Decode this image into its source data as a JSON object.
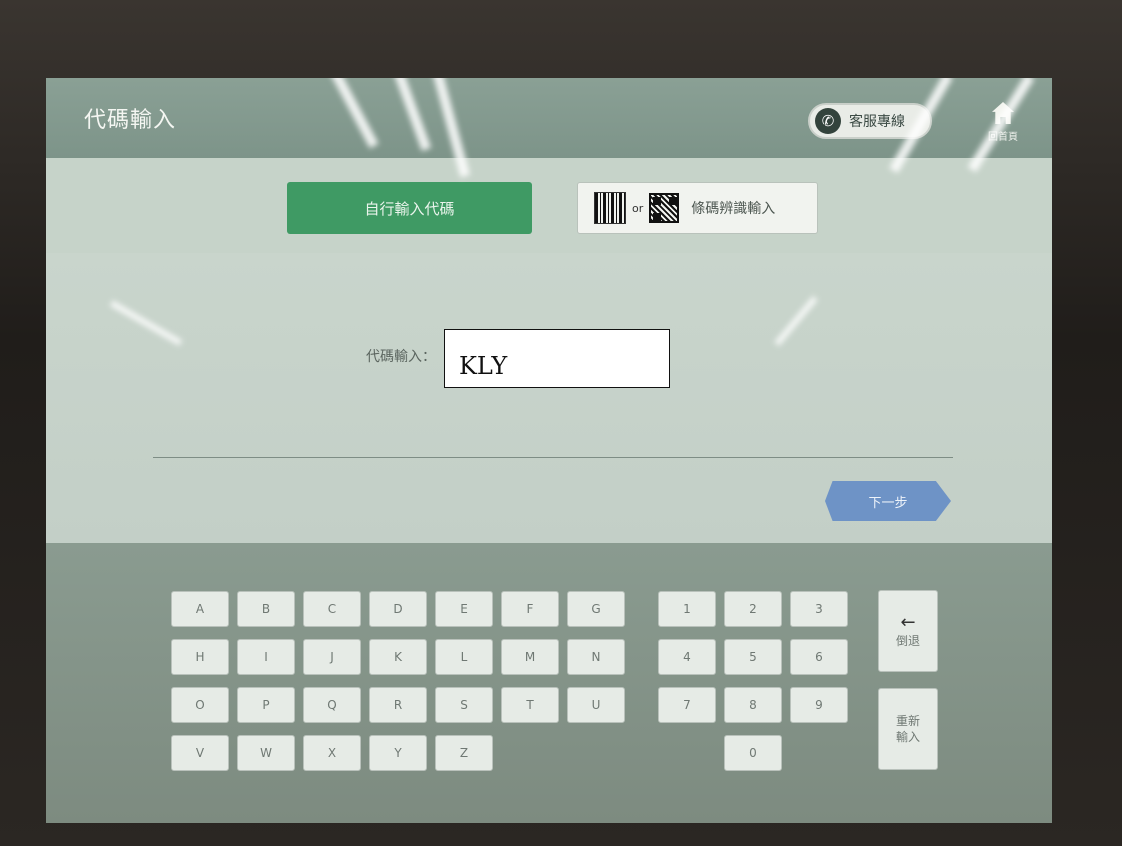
{
  "header": {
    "title": "代碼輸入",
    "service_label": "客服專線",
    "home_label": "回首頁"
  },
  "tabs": {
    "manual_label": "自行輸入代碼",
    "scan_or": "or",
    "scan_label": "條碼辨識輸入"
  },
  "form": {
    "code_label": "代碼輸入：",
    "code_value": "KLY",
    "next_label": "下一步"
  },
  "keyboard": {
    "letters": [
      [
        "A",
        "B",
        "C",
        "D",
        "E",
        "F",
        "G"
      ],
      [
        "H",
        "I",
        "J",
        "K",
        "L",
        "M",
        "N"
      ],
      [
        "O",
        "P",
        "Q",
        "R",
        "S",
        "T",
        "U"
      ],
      [
        "V",
        "W",
        "X",
        "Y",
        "Z"
      ]
    ],
    "digits": [
      [
        "1",
        "2",
        "3"
      ],
      [
        "4",
        "5",
        "6"
      ],
      [
        "7",
        "8",
        "9"
      ],
      [
        "0"
      ]
    ],
    "backspace_label": "倒退",
    "clear_label": "重新輸入"
  },
  "colors": {
    "accent_green": "#3f9a64",
    "next_blue": "#6e93c6"
  }
}
